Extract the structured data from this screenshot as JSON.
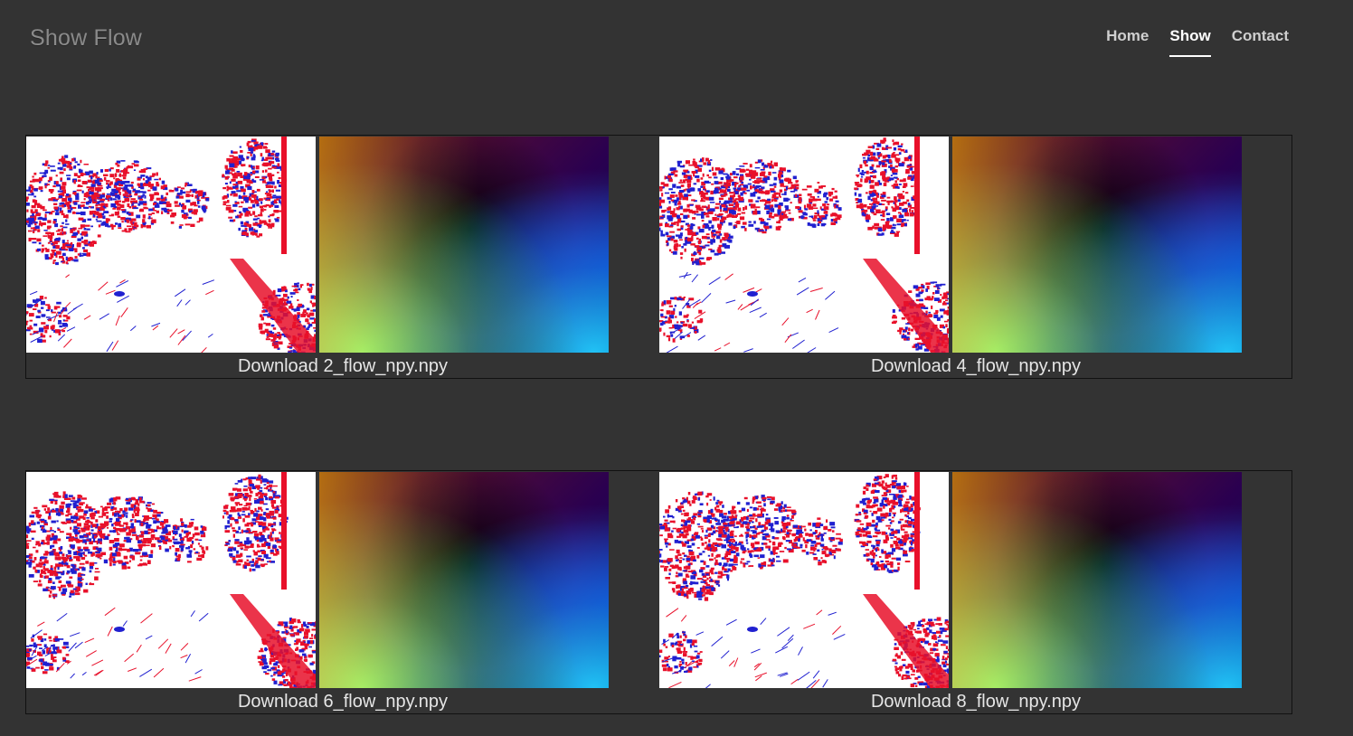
{
  "header": {
    "brand": "Show Flow",
    "nav": [
      {
        "label": "Home",
        "active": false
      },
      {
        "label": "Show",
        "active": true
      },
      {
        "label": "Contact",
        "active": false
      }
    ]
  },
  "items": [
    {
      "download_label": "Download 2_flow_npy.npy"
    },
    {
      "download_label": "Download 4_flow_npy.npy"
    },
    {
      "download_label": "Download 6_flow_npy.npy"
    },
    {
      "download_label": "Download 8_flow_npy.npy"
    }
  ],
  "colors": {
    "background": "#333333",
    "event_positive": "#e8102a",
    "event_negative": "#2020d0",
    "event_background": "#ffffff"
  }
}
